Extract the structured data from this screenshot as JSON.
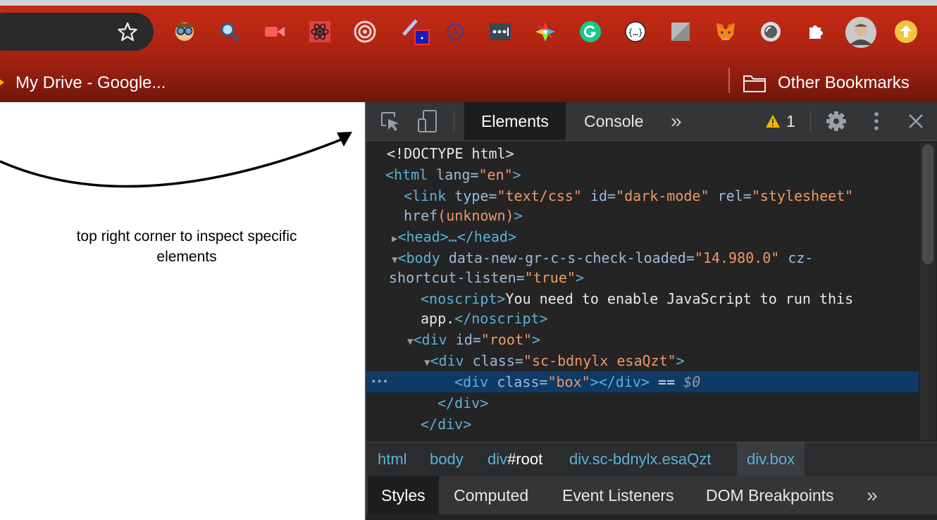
{
  "browser": {
    "bookmarks": {
      "my_drive": "My Drive - Google...",
      "other": "Other Bookmarks"
    }
  },
  "page": {
    "caption_line1": "top right corner to inspect specific",
    "caption_line2": "elements"
  },
  "devtools": {
    "tabs": [
      "Elements",
      "Console"
    ],
    "more_tabs": "»",
    "warning_count": "1",
    "dom": {
      "doctype": "<!DOCTYPE html>",
      "html_open_tag": "<html",
      "html_lang_attr": " lang=",
      "html_lang_val": "\"en\"",
      "link_tag": "<link",
      "link_type_attr": " type=",
      "link_type_val": "\"text/css\"",
      "link_id_attr": " id=",
      "link_id_val": "\"dark-mode\"",
      "link_rel_attr": " rel=",
      "link_rel_val": "\"stylesheet\"",
      "link_href_attr": "href",
      "link_href_val": "(unknown)",
      "head": "<head>…</head>",
      "body_tag": "<body",
      "body_attr1": " data-new-gr-c-s-check-loaded=",
      "body_val1": "\"14.980.0\"",
      "body_attr2_a": " cz-",
      "body_attr2_b": "shortcut-listen=",
      "body_val2": "\"true\"",
      "noscript_open": "<noscript>",
      "noscript_text_a": "You need to enable JavaScript to run this",
      "noscript_text_b": "app.",
      "noscript_close": "</noscript>",
      "div_root_tag": "<div",
      "div_root_attr": " id=",
      "div_root_val": "\"root\"",
      "div_sc_tag": "<div",
      "div_sc_attr": " class=",
      "div_sc_val": "\"sc-bdnylx esaQzt\"",
      "div_box_tag": "<div",
      "div_box_attr": " class=",
      "div_box_val": "\"box\"",
      "div_box_close": "></div>",
      "div_box_suffix": " == ",
      "div_box_dollar": "$0",
      "close_div_1": "</div>",
      "close_div_2": "</div>",
      "selected_dots": "•••"
    },
    "breadcrumbs": [
      {
        "tag": "html",
        "suffix": ""
      },
      {
        "tag": "body",
        "suffix": ""
      },
      {
        "tag": "div",
        "suffix": "#root"
      },
      {
        "tag": "div.sc-bdnylx.esaQzt",
        "suffix": ""
      },
      {
        "tag": "div.box",
        "suffix": ""
      }
    ],
    "sub_tabs": [
      "Styles",
      "Computed",
      "Event Listeners",
      "DOM Breakpoints"
    ],
    "more_sub_tabs": "»"
  },
  "colors": {
    "toolbar_red": "#b02512",
    "devtools_bg": "#242424",
    "selected_row": "#0f3a66",
    "tag_color": "#5db0d7",
    "attr_value_color": "#f29766"
  },
  "icons": [
    "star-icon",
    "extension-icons",
    "folder-icon",
    "inspect-icon",
    "device-toolbar-icon",
    "warning-icon",
    "settings-gear-icon",
    "kebab-menu-icon",
    "close-icon",
    "arrow-annotation"
  ]
}
